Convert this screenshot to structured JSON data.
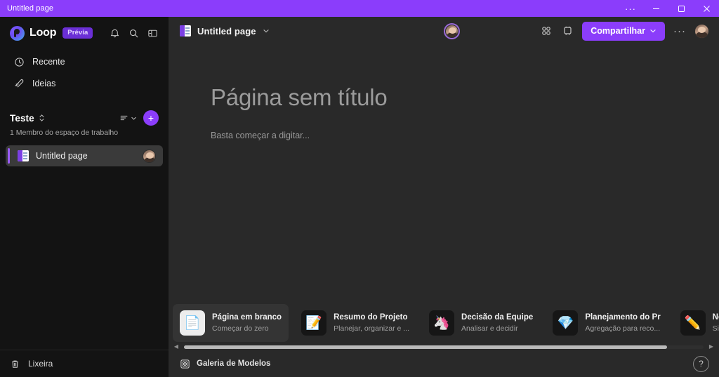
{
  "titlebar": {
    "title": "Untitled page",
    "menu_label": "···",
    "minimize_label": "minimize",
    "maximize_label": "maximize",
    "close_label": "close"
  },
  "sidebar": {
    "brand": "Loop",
    "brand_badge": "Prévia",
    "header_icons": [
      {
        "name": "bell-icon",
        "label": "Notificações"
      },
      {
        "name": "search-icon",
        "label": "Pesquisar"
      },
      {
        "name": "collapse-panel-icon",
        "label": "Recolher painel"
      }
    ],
    "nav": [
      {
        "label": "Recente",
        "icon": "clock-icon"
      },
      {
        "label": "Ideias",
        "icon": "ideas-icon"
      }
    ],
    "workspace": {
      "name": "Teste",
      "members": "1 Membro do espaço de trabalho",
      "sort_label": "Classificar",
      "add_label": "+"
    },
    "pages": [
      {
        "title": "Untitled page",
        "selected": true
      }
    ],
    "footer": {
      "label": "Lixeira",
      "icon": "trash-icon"
    }
  },
  "main": {
    "doc_name": "Untitled page",
    "share_label": "Compartilhar",
    "more_label": "···",
    "icons": [
      {
        "name": "apps-grid-icon"
      },
      {
        "name": "copy-link-icon"
      }
    ],
    "heading": "Página sem título",
    "body_placeholder": "Basta começar a digitar...",
    "templates": [
      {
        "title": "Página em branco",
        "subtitle": "Começar do zero",
        "icon": "blank-page-icon",
        "glyph": "📄",
        "light": true,
        "active": true
      },
      {
        "title": "Resumo do Projeto",
        "subtitle": "Planejar, organizar e ...",
        "icon": "project-summary-icon",
        "glyph": "📝",
        "light": false,
        "active": false
      },
      {
        "title": "Decisão da Equipe",
        "subtitle": "Analisar e decidir",
        "icon": "team-decision-icon",
        "glyph": "🦄",
        "light": false,
        "active": false
      },
      {
        "title": "Planejamento do Pr",
        "subtitle": "Agregação para reco...",
        "icon": "planning-icon",
        "glyph": "💎",
        "light": false,
        "active": false
      },
      {
        "title": "Notas da Reunião",
        "subtitle": "Sincronizar e compa...",
        "icon": "meeting-notes-icon",
        "glyph": "✏️",
        "light": false,
        "active": false
      }
    ],
    "scroll": {
      "left_arrow": "◀",
      "right_arrow": "▶"
    },
    "gallery_label": "Galeria de Modelos",
    "help_label": "?"
  }
}
